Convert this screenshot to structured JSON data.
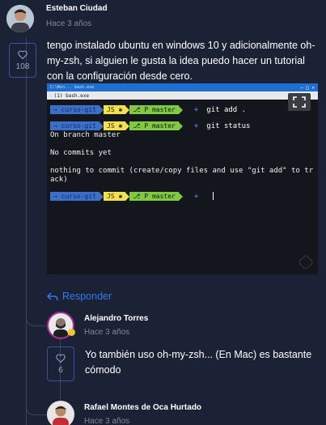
{
  "comments": [
    {
      "author": "Esteban Ciudad",
      "time": "Hace 3 años",
      "likes": "108",
      "text_lines": [
        "tengo instalado ubuntu en windows 10 y adicionalmente oh-",
        "my-zsh, si alguien le gusta la idea puedo hacer un tutorial",
        "con la configuración desde cero."
      ]
    }
  ],
  "terminal": {
    "title": "C:\\Win... bash.exe",
    "tab_label": "(1) bash.exe",
    "prompt_dir": "curso-git",
    "prompt_js": "JS",
    "prompt_branch": "master",
    "commands": [
      "git add .",
      "git status"
    ],
    "output_lines": [
      "On branch master",
      "",
      "No commits yet",
      "",
      "nothing to commit (create/copy files and use \"git add\" to tr",
      "ack)"
    ]
  },
  "reply_label": "Responder",
  "replies": [
    {
      "author": "Alejandro Torres",
      "time": "Hace 3 años",
      "likes": "6",
      "text_lines": [
        "Yo también uso oh-my-zsh... (En Mac) es bastante",
        "cómodo"
      ]
    },
    {
      "author": "Rafael Montes de Oca Hurtado",
      "time": "Hace 3 años"
    }
  ],
  "colors": {
    "background": "#1b2235",
    "accent": "#2f79f5",
    "like_border": "#3b4ea0"
  }
}
